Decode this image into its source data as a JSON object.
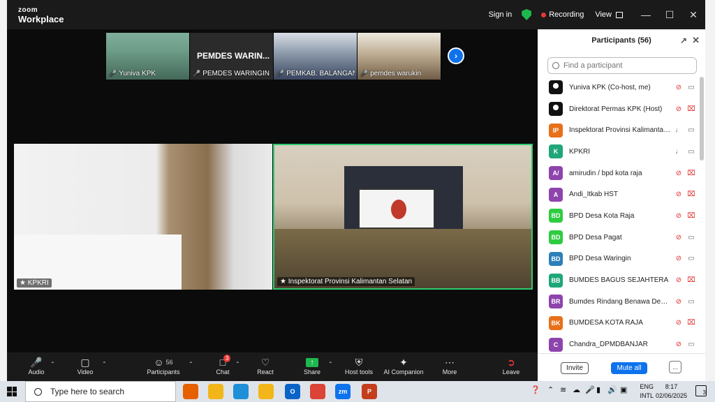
{
  "app": {
    "logo_line1": "zoom",
    "logo_line2": "Workplace",
    "sign_in": "Sign in",
    "recording": "Recording",
    "view": "View"
  },
  "thumbnails": [
    {
      "name": "Yuniva KPK",
      "muted": true
    },
    {
      "name": "PEMDES WARINGIN T...",
      "display": "PEMDES  WARIN...",
      "muted": true
    },
    {
      "name": "PEMKAB. BALANGAN ...",
      "muted": true
    },
    {
      "name": "pemdes warukin",
      "muted": true
    }
  ],
  "videos": {
    "left_label": "KPKRI",
    "right_label": "Inspektorat Provinsi Kalimantan Selatan"
  },
  "panel": {
    "title": "Participants (56)",
    "search_placeholder": "Find a participant",
    "participants": [
      {
        "initials": "",
        "name": "Yuniva KPK (Co-host, me)",
        "color": "photo",
        "mic": "off",
        "cam": "on"
      },
      {
        "initials": "",
        "name": "Direktorat Permas KPK (Host)",
        "color": "photo",
        "mic": "off",
        "cam": "off"
      },
      {
        "initials": "IP",
        "name": "Inspektorat Provinsi Kalimantan...",
        "color": "#e8701a",
        "mic": "on",
        "cam": "on"
      },
      {
        "initials": "K",
        "name": "KPKRI",
        "color": "#1fa67a",
        "mic": "on",
        "cam": "on"
      },
      {
        "initials": "A/",
        "name": "amirudin / bpd kota raja",
        "color": "#8e44ad",
        "mic": "off",
        "cam": "off"
      },
      {
        "initials": "A",
        "name": "Andi_Itkab HST",
        "color": "#8e44ad",
        "mic": "off",
        "cam": "off"
      },
      {
        "initials": "BD",
        "name": "BPD Desa Kota Raja",
        "color": "#2ecc40",
        "mic": "off",
        "cam": "off"
      },
      {
        "initials": "BD",
        "name": "BPD Desa Pagat",
        "color": "#2ecc40",
        "mic": "off",
        "cam": "on"
      },
      {
        "initials": "BD",
        "name": "BPD Desa Waringin",
        "color": "#2c7fb8",
        "mic": "off",
        "cam": "on"
      },
      {
        "initials": "BB",
        "name": "BUMDES BAGUS SEJAHTERA",
        "color": "#1fa67a",
        "mic": "off",
        "cam": "off"
      },
      {
        "initials": "BR",
        "name": "Bumdes Rindang Benawa Desa ...",
        "color": "#8e44ad",
        "mic": "off",
        "cam": "on"
      },
      {
        "initials": "BK",
        "name": "BUMDESA KOTA RAJA",
        "color": "#e8701a",
        "mic": "off",
        "cam": "off"
      },
      {
        "initials": "C",
        "name": "Chandra_DPMDBANJAR",
        "color": "#8e44ad",
        "mic": "off",
        "cam": "on"
      }
    ],
    "invite": "Invite",
    "mute_all": "Mute all",
    "more": "..."
  },
  "toolbar": {
    "audio": "Audio",
    "video": "Video",
    "participants": "Participants",
    "participants_count": "56",
    "chat": "Chat",
    "chat_badge": "3",
    "react": "React",
    "share": "Share",
    "host_tools": "Host tools",
    "ai_companion": "AI Companion",
    "more": "More",
    "leave": "Leave"
  },
  "taskbar": {
    "search_placeholder": "Type here to search",
    "lang1": "ENG",
    "lang2": "INTL",
    "time": "8:17",
    "date": "02/06/2025",
    "notifications": "3",
    "apps": [
      {
        "name": "Firefox",
        "color": "#e66000",
        "label": ""
      },
      {
        "name": "File Explorer",
        "color": "#f2b619",
        "label": ""
      },
      {
        "name": "Edge",
        "color": "#1f8fd8",
        "label": ""
      },
      {
        "name": "Media Player",
        "color": "#f2b619",
        "label": ""
      },
      {
        "name": "Outlook",
        "color": "#0a64c8",
        "label": "O"
      },
      {
        "name": "Chrome",
        "color": "#db4437",
        "label": ""
      },
      {
        "name": "Zoom",
        "color": "#0e72ed",
        "label": "zm"
      },
      {
        "name": "PowerPoint",
        "color": "#c43e1c",
        "label": "P"
      }
    ]
  }
}
